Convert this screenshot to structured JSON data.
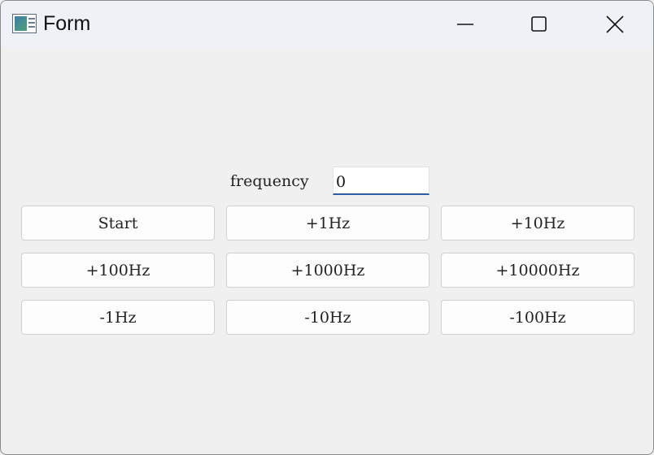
{
  "window": {
    "title": "Form"
  },
  "form": {
    "frequency_label": "frequency",
    "frequency_value": "0"
  },
  "buttons": [
    "Start",
    "+1Hz",
    "+10Hz",
    "+100Hz",
    "+1000Hz",
    "+10000Hz",
    "-1Hz",
    "-10Hz",
    "-100Hz"
  ],
  "icons": {
    "app": "app-form-icon",
    "minimize": "minimize-icon",
    "maximize": "maximize-icon",
    "close": "close-icon"
  },
  "colors": {
    "titlebar": "#eef2f7",
    "window_bg": "#f0f0f0",
    "input_accent": "#2c5fa8"
  }
}
